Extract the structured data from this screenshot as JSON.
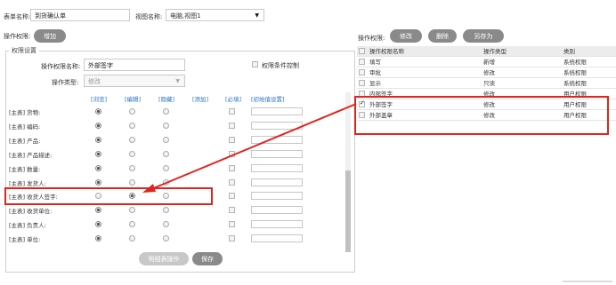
{
  "header": {
    "form_name_label": "表单名称:",
    "form_name_value": "到货确认单",
    "view_name_label": "视图名称:",
    "view_name_value": "电脑,视图1"
  },
  "left": {
    "perm_label": "操作权限:",
    "add_button": "增加",
    "fieldset_legend": "权限设置",
    "perm_name_label": "操作权限名称:",
    "perm_name_value": "外部签字",
    "condition_checkbox_label": "权限条件控制",
    "perm_type_label": "操作类型:",
    "perm_type_value": "修改",
    "columns": [
      "[浏览]",
      "[编辑]",
      "[隐藏]",
      "[添加]",
      "[必填]",
      "[初始值设置]"
    ],
    "rows": [
      {
        "label": "[主表] 货物:",
        "selected": 0
      },
      {
        "label": "[主表] 编码:",
        "selected": 0
      },
      {
        "label": "[主表] 产品:",
        "selected": 0
      },
      {
        "label": "[主表] 产品描述:",
        "selected": 0
      },
      {
        "label": "[主表] 数量:",
        "selected": 0
      },
      {
        "label": "[主表] 发货人:",
        "selected": 0
      },
      {
        "label": "[主表] 收货人签字:",
        "selected": 1
      },
      {
        "label": "[主表] 收货单位:",
        "selected": 0
      },
      {
        "label": "[主表] 负责人:",
        "selected": 0
      },
      {
        "label": "[主表] 单位:",
        "selected": 0
      }
    ],
    "detail_button": "明细表操作",
    "save_button": "保存"
  },
  "right": {
    "perm_label": "操作权限:",
    "edit_button": "修改",
    "delete_button": "删除",
    "save_as_button": "另存为",
    "table_headers": [
      "操作权限名称",
      "操作类型",
      "类别"
    ],
    "table_rows": [
      {
        "name": "填写",
        "type": "新增",
        "category": "系统权限",
        "checked": false
      },
      {
        "name": "审批",
        "type": "修改",
        "category": "系统权限",
        "checked": false
      },
      {
        "name": "显示",
        "type": "只读",
        "category": "系统权限",
        "checked": false
      },
      {
        "name": "内部签字",
        "type": "修改",
        "category": "用户权限",
        "checked": false
      },
      {
        "name": "外部签字",
        "type": "修改",
        "category": "用户权限",
        "checked": true
      },
      {
        "name": "外部盖章",
        "type": "修改",
        "category": "用户权限",
        "checked": false
      }
    ]
  },
  "colors": {
    "highlight": "#e0251e",
    "link": "#2a73c9",
    "button": "#8a8a8a"
  }
}
